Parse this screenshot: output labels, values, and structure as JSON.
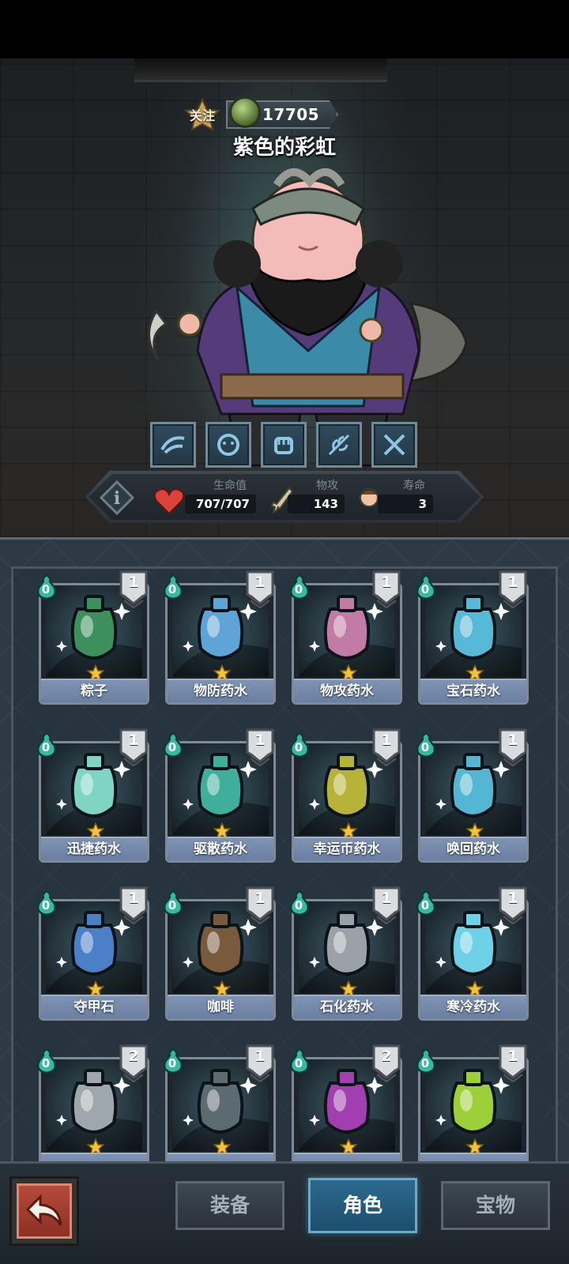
{
  "hero": {
    "follow_label": "关注",
    "score": "17705",
    "name": "紫色的彩虹"
  },
  "skills": [
    {
      "icon": "dash-skill-icon"
    },
    {
      "icon": "mask-skill-icon"
    },
    {
      "icon": "fist-skill-icon"
    },
    {
      "icon": "leaf-skill-icon"
    },
    {
      "icon": "crossed-swords-skill-icon"
    }
  ],
  "stats": {
    "hp_label": "生命值",
    "hp_value": "707/707",
    "attack_label": "物攻",
    "attack_value": "143",
    "lifespan_label": "寿命",
    "lifespan_value": "3"
  },
  "items": [
    {
      "name": "粽子",
      "cost": "0",
      "level": "1",
      "stars": 1,
      "art": "zongzi",
      "color": "#3d8f5b"
    },
    {
      "name": "物防药水",
      "cost": "0",
      "level": "1",
      "stars": 1,
      "art": "potion-blue-rock",
      "color": "#5fa4d6"
    },
    {
      "name": "物攻药水",
      "cost": "0",
      "level": "1",
      "stars": 1,
      "art": "potion-pink-crystal",
      "color": "#c27aa6"
    },
    {
      "name": "宝石药水",
      "cost": "0",
      "level": "1",
      "stars": 1,
      "art": "potion-gem",
      "color": "#58b8d8"
    },
    {
      "name": "迅捷药水",
      "cost": "0",
      "level": "1",
      "stars": 1,
      "art": "potion-swift",
      "color": "#7fd4c4"
    },
    {
      "name": "驱散药水",
      "cost": "0",
      "level": "1",
      "stars": 1,
      "art": "potion-dispel",
      "color": "#3fae9a"
    },
    {
      "name": "幸运币药水",
      "cost": "0",
      "level": "1",
      "stars": 1,
      "art": "potion-lucky-coin",
      "color": "#b7b33a"
    },
    {
      "name": "唤回药水",
      "cost": "0",
      "level": "1",
      "stars": 1,
      "art": "potion-recall",
      "color": "#55b6d4"
    },
    {
      "name": "夺甲石",
      "cost": "0",
      "level": "1",
      "stars": 1,
      "art": "stone-armor-break",
      "color": "#4b7fc6"
    },
    {
      "name": "咖啡",
      "cost": "0",
      "level": "1",
      "stars": 1,
      "art": "coffee",
      "color": "#7a5a3c"
    },
    {
      "name": "石化药水",
      "cost": "0",
      "level": "1",
      "stars": 1,
      "art": "potion-petrify",
      "color": "#9aa2a8"
    },
    {
      "name": "寒冷药水",
      "cost": "0",
      "level": "1",
      "stars": 1,
      "art": "potion-cold",
      "color": "#6fd1e8"
    },
    {
      "name": "",
      "cost": "0",
      "level": "2",
      "stars": 1,
      "art": "armor-scale",
      "color": "#9ea8ac"
    },
    {
      "name": "",
      "cost": "0",
      "level": "1",
      "stars": 1,
      "art": "stone-spiral",
      "color": "#5c6b72"
    },
    {
      "name": "",
      "cost": "0",
      "level": "2",
      "stars": 1,
      "art": "potion-purple",
      "color": "#a13fb0"
    },
    {
      "name": "",
      "cost": "0",
      "level": "1",
      "stars": 1,
      "art": "potion-green-bug",
      "color": "#9ccf3a"
    }
  ],
  "nav": {
    "back_icon": "back-arrow-icon",
    "tab_equipment": "装备",
    "tab_character": "角色",
    "tab_treasure": "宝物"
  },
  "colors": {
    "panel": "#2d3945",
    "card_label": "#7f93b4",
    "active_tab": "#2a6a8f",
    "back_button": "#b54a3c"
  }
}
